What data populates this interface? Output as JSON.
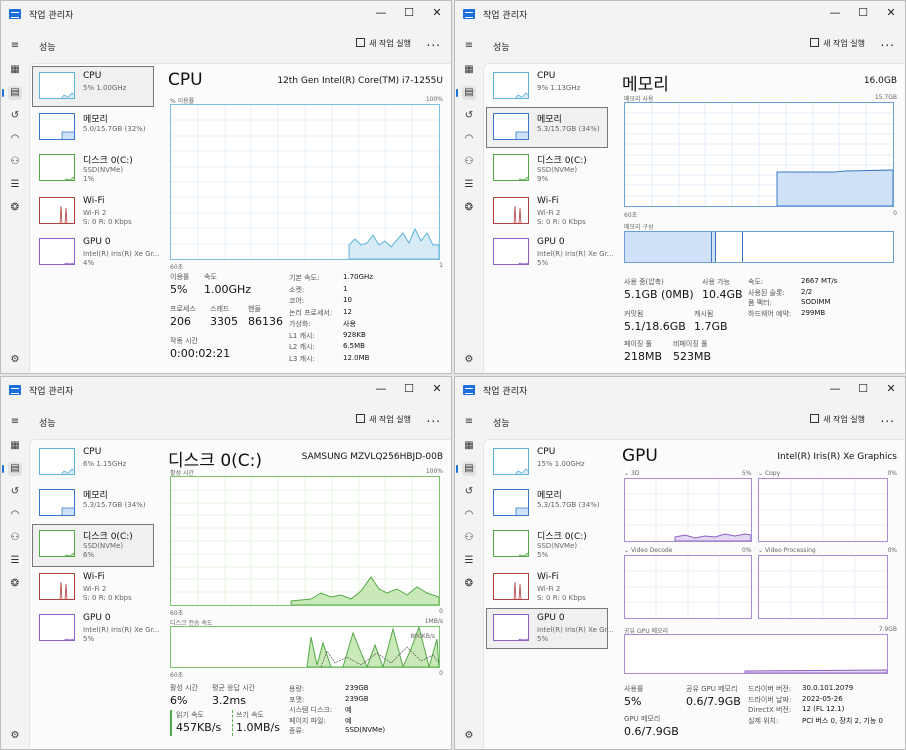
{
  "colors": {
    "cpu": "#5fb3d9",
    "cpu_fill": "#d6ebf5",
    "mem": "#3b78c9",
    "mem_fill": "#cfe1f7",
    "disk": "#55a84a",
    "disk_fill": "#c9e9b8",
    "wifi": "#b0413e",
    "gpu": "#8a5fc7",
    "gpu_fill": "#e4d8f3",
    "accent": "#1e6fd9"
  },
  "app": {
    "title": "작업 관리자",
    "section": "성능",
    "run_task": "새 작업 실행",
    "more": "...",
    "min": "—",
    "max": "☐",
    "close": "✕"
  },
  "rail_icons": [
    "menu-icon",
    "processes-icon",
    "performance-icon",
    "app-history-icon",
    "startup-icon",
    "users-icon",
    "details-icon",
    "services-icon",
    "settings-icon"
  ],
  "sidebar_windows": [
    [
      {
        "title": "CPU",
        "sub": "5% 1.00GHz",
        "sub2": ""
      },
      {
        "title": "메모리",
        "sub": "5.0/15.7GB (32%)",
        "sub2": ""
      },
      {
        "title": "디스크 0(C:)",
        "sub": "SSD(NVMe)",
        "sub2": "1%"
      },
      {
        "title": "Wi-Fi",
        "sub": "Wi-Fi 2",
        "sub2": "S: 0 R: 0 Kbps"
      },
      {
        "title": "GPU 0",
        "sub": "Intel(R) Iris(R) Xe Gr...",
        "sub2": "4%"
      }
    ],
    [
      {
        "title": "CPU",
        "sub": "9% 1.13GHz",
        "sub2": ""
      },
      {
        "title": "메모리",
        "sub": "5.3/15.7GB (34%)",
        "sub2": ""
      },
      {
        "title": "디스크 0(C:)",
        "sub": "SSD(NVMe)",
        "sub2": "9%"
      },
      {
        "title": "Wi-Fi",
        "sub": "Wi-Fi 2",
        "sub2": "S: 0 R: 0 Kbps"
      },
      {
        "title": "GPU 0",
        "sub": "Intel(R) Iris(R) Xe Gr...",
        "sub2": "5%"
      }
    ],
    [
      {
        "title": "CPU",
        "sub": "6% 1.15GHz",
        "sub2": ""
      },
      {
        "title": "메모리",
        "sub": "5.3/15.7GB (34%)",
        "sub2": ""
      },
      {
        "title": "디스크 0(C:)",
        "sub": "SSD(NVMe)",
        "sub2": "6%"
      },
      {
        "title": "Wi-Fi",
        "sub": "Wi-Fi 2",
        "sub2": "S: 0 R: 0 Kbps"
      },
      {
        "title": "GPU 0",
        "sub": "Intel(R) Iris(R) Xe Gr...",
        "sub2": "5%"
      }
    ],
    [
      {
        "title": "CPU",
        "sub": "15% 1.00GHz",
        "sub2": ""
      },
      {
        "title": "메모리",
        "sub": "5.3/15.7GB (34%)",
        "sub2": ""
      },
      {
        "title": "디스크 0(C:)",
        "sub": "SSD(NVMe)",
        "sub2": "5%"
      },
      {
        "title": "Wi-Fi",
        "sub": "Wi-Fi 2",
        "sub2": "S: 0 R: 0 Kbps"
      },
      {
        "title": "GPU 0",
        "sub": "Intel(R) Iris(R) Xe Gr...",
        "sub2": "5%"
      }
    ]
  ],
  "cpu": {
    "title": "CPU",
    "model": "12th Gen Intel(R) Core(TM) i7-1255U",
    "util_label": "% 이용률",
    "util_max": "100%",
    "axis_left": "60초",
    "axis_right": "1",
    "stats": [
      {
        "label": "이용률",
        "value": "5%"
      },
      {
        "label": "속도",
        "value": "1.00GHz"
      },
      {
        "label": "프로세스",
        "value": "206"
      },
      {
        "label": "스레드",
        "value": "3305"
      },
      {
        "label": "핸들",
        "value": "86136"
      },
      {
        "label": "작동 시간",
        "value": "0:00:02:21"
      }
    ],
    "specs": [
      {
        "k": "기본 속도:",
        "v": "1.70GHz"
      },
      {
        "k": "소켓:",
        "v": "1"
      },
      {
        "k": "코어:",
        "v": "10"
      },
      {
        "k": "논리 프로세서:",
        "v": "12"
      },
      {
        "k": "가상화:",
        "v": "사용"
      },
      {
        "k": "L1 캐시:",
        "v": "928KB"
      },
      {
        "k": "L2 캐시:",
        "v": "6.5MB"
      },
      {
        "k": "L3 캐시:",
        "v": "12.0MB"
      }
    ]
  },
  "memory": {
    "title": "메모리",
    "total": "16.0GB",
    "usage_label": "메모리 사용",
    "usage_max": "15.7GB",
    "axis_left": "60초",
    "axis_right": "0",
    "composition_label": "메모리 구성",
    "stats": [
      {
        "label": "사용 중(압축)",
        "value": "5.1GB (0MB)"
      },
      {
        "label": "사용 가능",
        "value": "10.4GB"
      },
      {
        "label": "커밋됨",
        "value": "5.1/18.6GB"
      },
      {
        "label": "캐시됨",
        "value": "1.7GB"
      },
      {
        "label": "페이징 풀",
        "value": "218MB"
      },
      {
        "label": "비페이징 풀",
        "value": "523MB"
      }
    ],
    "specs": [
      {
        "k": "속도:",
        "v": "2667 MT/s"
      },
      {
        "k": "사용된 슬롯:",
        "v": "2/2"
      },
      {
        "k": "폼 팩터:",
        "v": "SODIMM"
      },
      {
        "k": "하드웨어 예약:",
        "v": "299MB"
      }
    ]
  },
  "disk": {
    "title": "디스크 0(C:)",
    "model": "SAMSUNG MZVLQ256HBJD-00B",
    "active_label": "활성 시간",
    "active_max": "100%",
    "axis_left": "60초",
    "axis_right": "0",
    "transfer_label": "디스크 전송 속도",
    "transfer_max": "1MB/s",
    "transfer_mark": "800KB/s",
    "axis2_left": "60초",
    "axis2_right": "0",
    "stats": [
      {
        "label": "활성 시간",
        "value": "6%"
      },
      {
        "label": "평균 응답 시간",
        "value": "3.2ms"
      },
      {
        "label": "읽기 속도",
        "value": "457KB/s"
      },
      {
        "label": "쓰기 속도",
        "value": "1.0MB/s"
      }
    ],
    "specs": [
      {
        "k": "용량:",
        "v": "239GB"
      },
      {
        "k": "포맷:",
        "v": "239GB"
      },
      {
        "k": "시스템 디스크:",
        "v": "예"
      },
      {
        "k": "페이지 파일:",
        "v": "예"
      },
      {
        "k": "종류:",
        "v": "SSD(NVMe)"
      }
    ]
  },
  "gpu": {
    "title": "GPU",
    "model": "Intel(R) Iris(R) Xe Graphics",
    "engines": [
      {
        "name": "3D",
        "pct": "5%"
      },
      {
        "name": "Copy",
        "pct": "0%"
      },
      {
        "name": "Video Decode",
        "pct": "0%"
      },
      {
        "name": "Video Processing",
        "pct": "0%"
      }
    ],
    "shared_label": "공유 GPU 메모리",
    "shared_max": "7.9GB",
    "stats": [
      {
        "label": "사용률",
        "value": "5%"
      },
      {
        "label": "공유 GPU 메모리",
        "value": "0.6/7.9GB"
      },
      {
        "label": "GPU 메모리",
        "value": "0.6/7.9GB"
      }
    ],
    "specs": [
      {
        "k": "드라이버 버전:",
        "v": "30.0.101.2079"
      },
      {
        "k": "드라이버 날짜:",
        "v": "2022-05-26"
      },
      {
        "k": "DirectX 버전:",
        "v": "12 (FL 12.1)"
      },
      {
        "k": "실제 위치:",
        "v": "PCI 버스 0, 장치 2, 기능 0"
      }
    ]
  }
}
